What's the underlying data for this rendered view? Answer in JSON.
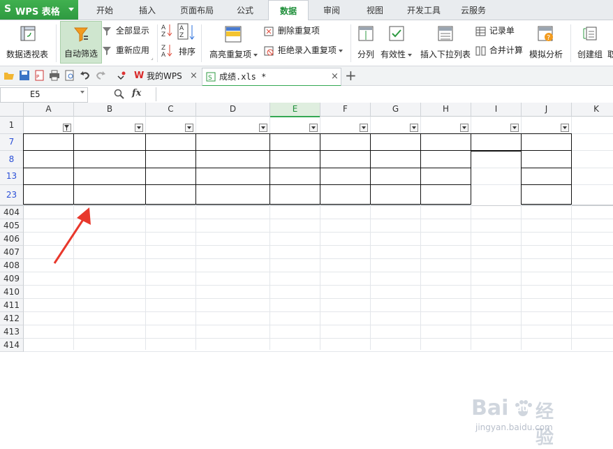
{
  "app": {
    "name": "WPS 表格",
    "logo": "S"
  },
  "menu_tabs": [
    "开始",
    "插入",
    "页面布局",
    "公式",
    "数据",
    "审阅",
    "视图",
    "开发工具",
    "云服务"
  ],
  "active_tab": "数据",
  "ribbon": {
    "pivot": "数据透视表",
    "autofilter": "自动筛选",
    "show_all": "全部显示",
    "reapply": "重新应用",
    "sort": "排序",
    "highlight_dup": "高亮重复项",
    "remove_dup": "删除重复项",
    "reject_dup": "拒绝录入重复项",
    "split": "分列",
    "validity": "有效性",
    "insert_dropdown": "插入下拉列表",
    "record_form": "记录单",
    "consolidate": "合并计算",
    "simulate": "模拟分析",
    "group": "创建组",
    "cut_tail": "取"
  },
  "doc_tabs": [
    {
      "label": "我的WPS",
      "active": false
    },
    {
      "label": "成绩.xls *",
      "active": true
    }
  ],
  "formula_bar": {
    "cell_ref": "E5",
    "fx": "fx",
    "value": ""
  },
  "columns": [
    "A",
    "B",
    "C",
    "D",
    "E",
    "F",
    "G",
    "H",
    "I",
    "J",
    "K"
  ],
  "selected_column": "E",
  "rows": [
    "1",
    "7",
    "8",
    "13",
    "23",
    "404",
    "405",
    "406",
    "407",
    "408",
    "409",
    "410",
    "411",
    "412",
    "413",
    "414"
  ],
  "filtered_rows": [
    "7",
    "8",
    "13",
    "23"
  ],
  "watermark": {
    "brand": "Bai",
    "paw": "du",
    "cn": "经验",
    "url": "jingyan.baidu.com"
  },
  "colors": {
    "accent": "#34a853",
    "filtered_row_text": "#2a4fd7",
    "annotation_arrow": "#e8382c"
  }
}
